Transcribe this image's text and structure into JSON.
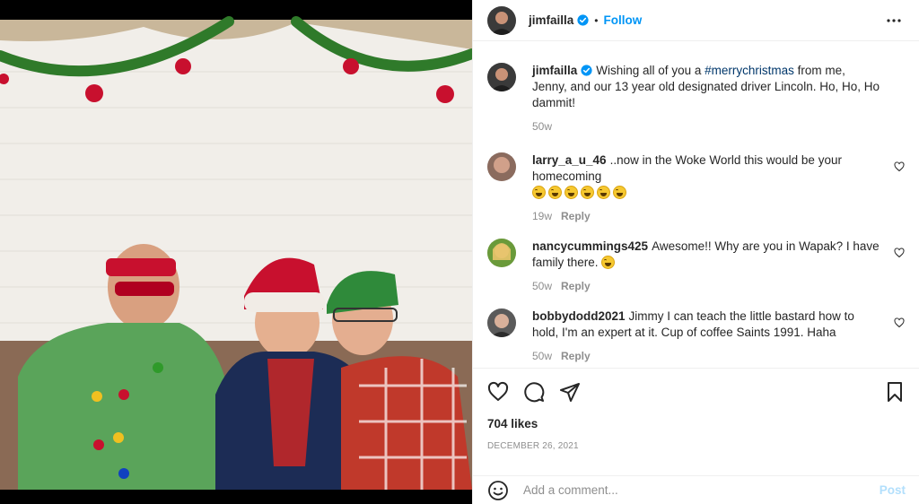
{
  "post": {
    "author": "jimfailla",
    "follow_label": "Follow",
    "dot": "•",
    "caption": {
      "before": "Wishing all of you a ",
      "hashtag": "#merrychristmas",
      "after": " from me, Jenny, and our 13 year old designated driver Lincoln. Ho, Ho, Ho dammit!"
    },
    "caption_age": "50w"
  },
  "comments": [
    {
      "user": "larry_a_u_46",
      "text": "..now in the Woke World this would be your homecoming",
      "emoji_count": 6,
      "age": "19w",
      "reply": "Reply"
    },
    {
      "user": "nancycummings425",
      "text": "Awesome!! Why are you in Wapak? I have family there.",
      "emoji_count": 1,
      "age": "50w",
      "reply": "Reply"
    },
    {
      "user": "bobbydodd2021",
      "text": "Jimmy I can teach the little bastard how to hold, I'm an expert at it. Cup of coffee Saints 1991. Haha",
      "emoji_count": 0,
      "age": "50w",
      "reply": "Reply"
    }
  ],
  "likes": "704 likes",
  "date": "DECEMBER 26, 2021",
  "add_comment": {
    "placeholder": "Add a comment...",
    "post_label": "Post"
  },
  "icons": {
    "header": [
      "verified-badge-icon",
      "more-options-icon"
    ],
    "actions": [
      "like-heart-icon",
      "comment-icon",
      "share-icon",
      "save-bookmark-icon"
    ],
    "comment_like": "small-heart-icon",
    "composer": "emoji-smile-icon"
  },
  "colors": {
    "link": "#0095f6",
    "hashtag": "#00376b",
    "muted": "#8e8e8e",
    "post_disabled": "#b2dffc"
  }
}
